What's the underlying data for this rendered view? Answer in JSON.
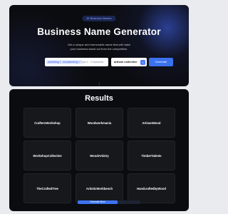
{
  "hero": {
    "badge": "AI Business Names",
    "title": "Business Name Generator",
    "subtitle": "Get a unique and memorable name that will make your business stand out from the competition."
  },
  "search": {
    "chips": [
      "marketing ×",
      "woodworking ×"
    ],
    "placeholder": "Type 2 - 4 keywords",
    "keyword_value": "artisan collective",
    "clear_icon": "×",
    "generate_label": "Generate"
  },
  "connector_icon": "↓",
  "results": {
    "title": "Results",
    "names": [
      "CraftersWorkshop",
      "Woodworkmania",
      "ArtisanWood",
      "WorkshopCollective",
      "WoodArtistry",
      "TimberTalents",
      "TheCraftedTree",
      "ArtisticWorkbench",
      "HandcraftedbyWood"
    ],
    "more_label": "Generate More"
  }
}
